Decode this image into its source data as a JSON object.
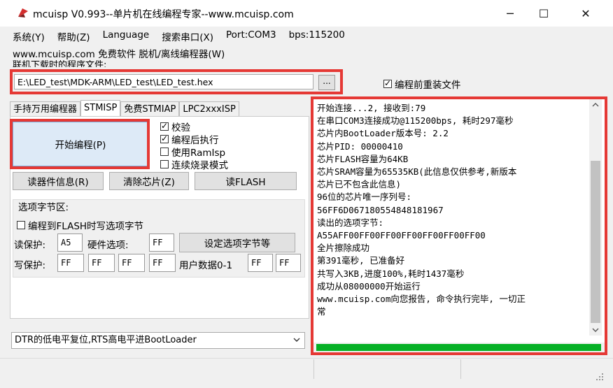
{
  "window": {
    "title": "mcuisp V0.993--单片机在线编程专家--www.mcuisp.com",
    "minimize": "─",
    "maximize": "☐",
    "close": "✕"
  },
  "menu": [
    "系统(Y)",
    "帮助(Z)",
    "Language",
    "搜索串口(X)",
    "Port:COM3",
    "bps:115200"
  ],
  "subline": "www.mcuisp.com 免费软件 脱机/离线编程器(W)",
  "cutline": "联机下载时的程序文件:",
  "file": {
    "path": "E:\\LED_test\\MDK-ARM\\LED_test\\LED_test.hex",
    "browse": "...",
    "reload_label": "编程前重装文件",
    "reload_checked": true
  },
  "tabs": [
    {
      "label": "手持万用编程器",
      "active": false
    },
    {
      "label": "STMISP",
      "active": true
    },
    {
      "label": "免费STMIAP",
      "active": false
    },
    {
      "label": "LPC2xxxISP",
      "active": false
    }
  ],
  "program_button": "开始编程(P)",
  "options": [
    {
      "label": "校验",
      "checked": true
    },
    {
      "label": "编程后执行",
      "checked": true
    },
    {
      "label": "使用RamIsp",
      "checked": false
    },
    {
      "label": "连续烧录模式",
      "checked": false
    }
  ],
  "buttons": {
    "read_info": "读器件信息(R)",
    "erase": "清除芯片(Z)",
    "read_flash": "读FLASH"
  },
  "option_bytes": {
    "group_title": "选项字节区:",
    "write_when_program": "编程到FLASH时写选项字节",
    "write_checked": false,
    "read_protect_label": "读保护:",
    "read_protect_value": "A5",
    "hw_option_label": "硬件选项:",
    "hw_option_value": "FF",
    "set_button": "设定选项字节等",
    "write_protect_label": "写保护:",
    "write_protect_values": [
      "FF",
      "FF",
      "FF",
      "FF"
    ],
    "user_data_label": "用户数据0-1",
    "user_data_values": [
      "FF",
      "FF"
    ]
  },
  "reset_mode": "DTR的低电平复位,RTS高电平进BootLoader",
  "log": [
    "开始连接...2, 接收到:79",
    "在串口COM3连接成功@115200bps, 耗时297毫秒",
    "芯片内BootLoader版本号: 2.2",
    "芯片PID: 00000410",
    "芯片FLASH容量为64KB",
    "芯片SRAM容量为65535KB(此信息仅供参考,新版本",
    "芯片已不包含此信息)",
    "96位的芯片唯一序列号:",
    "56FF6D067180554848181967",
    "读出的选项字节:",
    "A55AFF00FF00FF00FF00FF00FF00FF00",
    "全片擦除成功",
    "第391毫秒, 已准备好",
    "共写入3KB,进度100%,耗时1437毫秒",
    "成功从08000000开始运行",
    "www.mcuisp.com向您报告, 命令执行完毕, 一切正",
    "常"
  ],
  "progress": 100,
  "colors": {
    "highlight": "#e53935",
    "progress": "#06b025",
    "primary_button": "#ddeaf7"
  }
}
